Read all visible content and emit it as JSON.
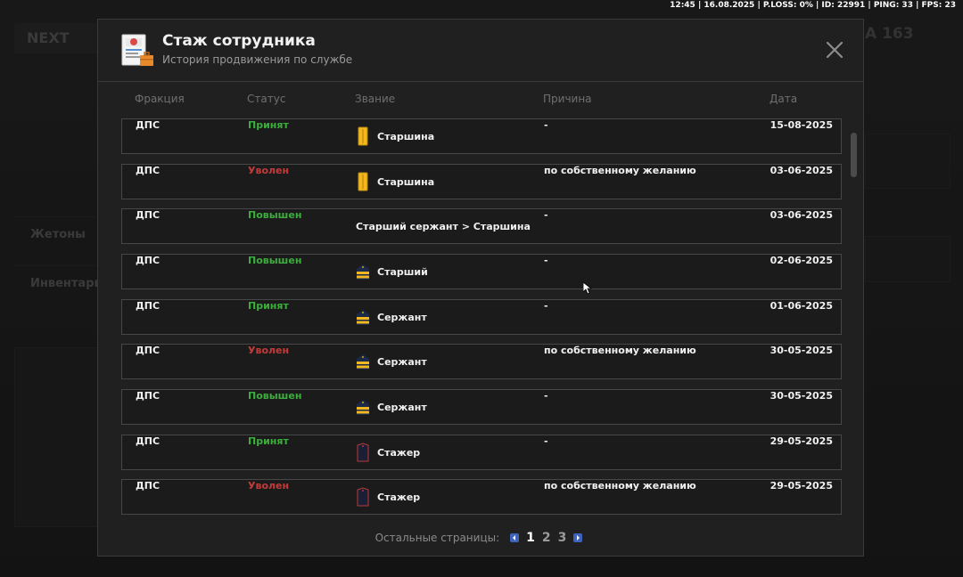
{
  "status_bar": "12:45 | 16.08.2025 | P.LOSS: 0% | ID: 22991 | PING: 33 | FPS: 23",
  "background": {
    "logo": "NEXT",
    "level": "A 163",
    "menu": [
      "Жетоны",
      "Инвентарь"
    ]
  },
  "modal": {
    "title": "Стаж сотрудника",
    "subtitle": "История продвижения по службе",
    "columns": {
      "faction": "Фракция",
      "status": "Статус",
      "rank": "Звание",
      "reason": "Причина",
      "date": "Дата"
    },
    "rows": [
      {
        "faction": "ДПС",
        "status": "Принят",
        "status_type": "accepted",
        "rank": "Старшина",
        "rank_icon": "starshina",
        "reason": "-",
        "date": "15-08-2025"
      },
      {
        "faction": "ДПС",
        "status": "Уволен",
        "status_type": "fired",
        "rank": "Старшина",
        "rank_icon": "starshina",
        "reason": "по собственному желанию",
        "date": "03-06-2025"
      },
      {
        "faction": "ДПС",
        "status": "Повышен",
        "status_type": "promoted",
        "rank": "Старший сержант > Старшина",
        "rank_icon": "",
        "reason": "-",
        "date": "03-06-2025"
      },
      {
        "faction": "ДПС",
        "status": "Повышен",
        "status_type": "promoted",
        "rank": "Старший",
        "rank_icon": "stripes",
        "reason": "-",
        "date": "02-06-2025"
      },
      {
        "faction": "ДПС",
        "status": "Принят",
        "status_type": "accepted",
        "rank": "Сержант",
        "rank_icon": "stripes",
        "reason": "-",
        "date": "01-06-2025"
      },
      {
        "faction": "ДПС",
        "status": "Уволен",
        "status_type": "fired",
        "rank": "Сержант",
        "rank_icon": "stripes",
        "reason": "по собственному желанию",
        "date": "30-05-2025"
      },
      {
        "faction": "ДПС",
        "status": "Повышен",
        "status_type": "promoted",
        "rank": "Сержант",
        "rank_icon": "stripes",
        "reason": "-",
        "date": "30-05-2025"
      },
      {
        "faction": "ДПС",
        "status": "Принят",
        "status_type": "accepted",
        "rank": "Стажер",
        "rank_icon": "trainee",
        "reason": "-",
        "date": "29-05-2025"
      },
      {
        "faction": "ДПС",
        "status": "Уволен",
        "status_type": "fired",
        "rank": "Стажер",
        "rank_icon": "trainee",
        "reason": "по собственному желанию",
        "date": "29-05-2025"
      }
    ],
    "pagination": {
      "label": "Остальные страницы:",
      "pages": [
        "1",
        "2",
        "3"
      ],
      "current": "1"
    }
  },
  "colors": {
    "accepted": "#3cae3c",
    "promoted": "#3cae3c",
    "fired": "#c43a3a",
    "accent": "#3f63b8"
  }
}
